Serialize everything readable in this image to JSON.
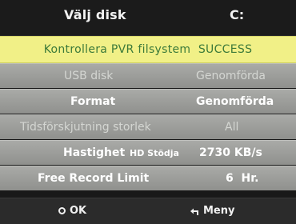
{
  "header": {
    "title": "Välj disk",
    "drive": "C:"
  },
  "status": {
    "text": "Kontrollera PVR filsystem  SUCCESS"
  },
  "rows": [
    {
      "label": "USB disk",
      "value": "Genomförda",
      "state": "disabled"
    },
    {
      "label": "Format",
      "value": "Genomförda",
      "state": "active"
    },
    {
      "label": "Tidsförskjutning storlek",
      "value": "All",
      "state": "disabled"
    },
    {
      "label": "Hastighet",
      "sub": "HD Stödja",
      "value": "2730 KB/s",
      "state": "active"
    },
    {
      "label": "Free Record Limit",
      "value": "6  Hr.",
      "state": "active"
    }
  ],
  "footer": {
    "ok_label": "OK",
    "ok_icon": "ok-circle-icon",
    "menu_label": "Meny",
    "menu_icon": "return-arrow-icon"
  },
  "colors": {
    "status_bg": "#f1f087",
    "status_text": "#3c7a3a",
    "row_bg": "#9d9e9b"
  }
}
